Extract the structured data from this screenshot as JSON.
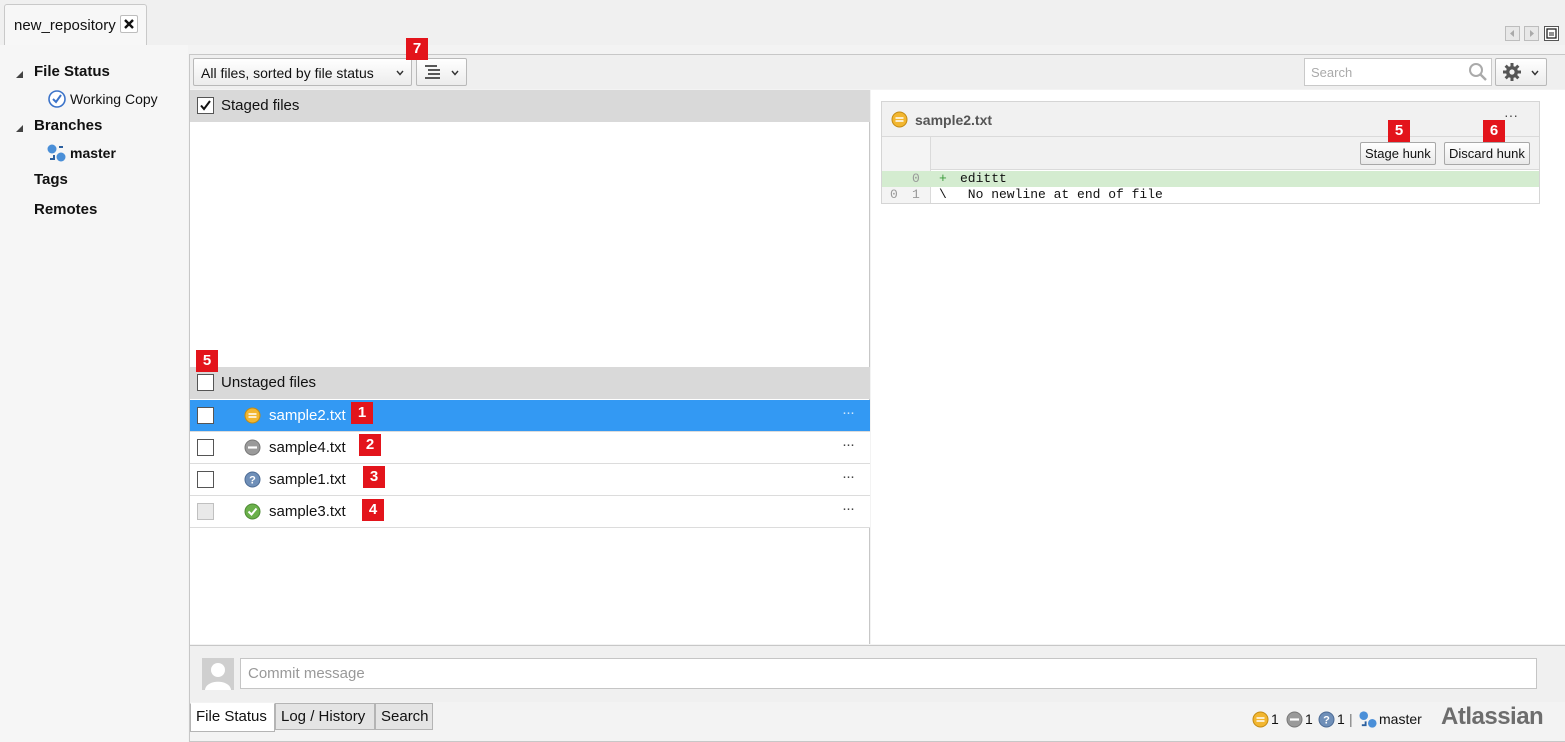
{
  "repo_tab": {
    "title": "new_repository",
    "close_glyph": "✕"
  },
  "sidebar": {
    "file_status": "File Status",
    "working_copy": "Working Copy",
    "branches": "Branches",
    "branch_master": "master",
    "tags": "Tags",
    "remotes": "Remotes"
  },
  "toolbar": {
    "filter_label": "All files, sorted by file status",
    "search_placeholder": "Search",
    "chevron": "⌄"
  },
  "staged": {
    "label": "Staged files",
    "checked": true
  },
  "unstaged": {
    "label": "Unstaged files",
    "files": [
      {
        "name": "sample2.txt",
        "status": "modified",
        "badge": "1",
        "selected": true
      },
      {
        "name": "sample4.txt",
        "status": "removed",
        "badge": "2",
        "selected": false
      },
      {
        "name": "sample1.txt",
        "status": "untracked",
        "badge": "3",
        "selected": false
      },
      {
        "name": "sample3.txt",
        "status": "added",
        "badge": "4",
        "selected": false
      }
    ],
    "row_more": "···"
  },
  "diff": {
    "file_name": "sample2.txt",
    "more": "···",
    "stage_hunk": "Stage hunk",
    "discard_hunk": "Discard hunk",
    "lines": [
      {
        "old": "",
        "new": "0",
        "mark": "+",
        "code": "edittt"
      },
      {
        "old": "0",
        "new": "1",
        "mark": "\\",
        "code": " No newline at end of file"
      }
    ]
  },
  "commit": {
    "placeholder": "Commit message"
  },
  "bottom_tabs": [
    "File Status",
    "Log / History",
    "Search"
  ],
  "status": {
    "modified_count": "1",
    "removed_count": "1",
    "untracked_count": "1",
    "separator": "|",
    "branch": "master"
  },
  "brand": "Atlassian",
  "annotations": {
    "view_mode": "7",
    "unstaged_header": "5",
    "stage_hunk": "5",
    "discard_hunk": "6"
  },
  "colors": {
    "selection": "#3399f3",
    "badge": "#e3141b",
    "added_line": "#d4ecd0"
  }
}
